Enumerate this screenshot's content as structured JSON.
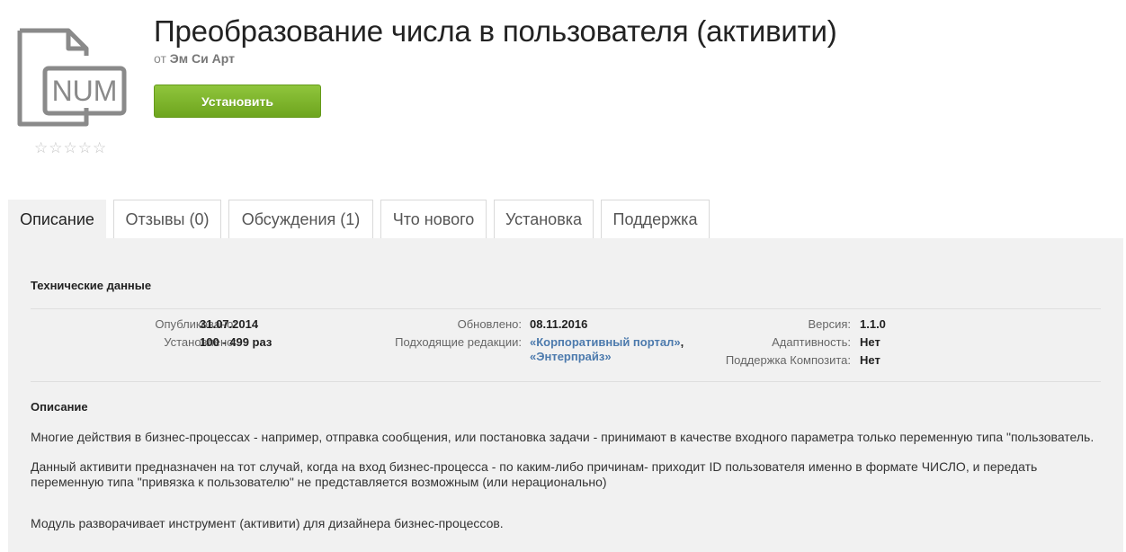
{
  "app": {
    "icon_text": "NUM",
    "title": "Преобразование числа в пользователя (активити)",
    "by_prefix": "от",
    "vendor": "Эм Си Арт",
    "install_label": "Установить",
    "rating": 0,
    "rating_max": 5
  },
  "tabs": [
    {
      "label": "Описание",
      "active": true
    },
    {
      "label": "Отзывы (0)",
      "active": false
    },
    {
      "label": "Обсуждения (1)",
      "active": false
    },
    {
      "label": "Что нового",
      "active": false
    },
    {
      "label": "Установка",
      "active": false
    },
    {
      "label": "Поддержка",
      "active": false
    }
  ],
  "tech": {
    "heading": "Технические данные",
    "published_label": "Опубликовано:",
    "published_value": "31.07.2014",
    "installed_label": "Установлено:",
    "installed_value": "100 - 499 раз",
    "updated_label": "Обновлено:",
    "updated_value": "08.11.2016",
    "editions_label": "Подходящие редакции:",
    "edition_1": "«Корпоративный портал»",
    "edition_sep": ",",
    "edition_2": "«Энтерпрайз»",
    "version_label": "Версия:",
    "version_value": "1.1.0",
    "adaptive_label": "Адаптивность:",
    "adaptive_value": "Нет",
    "composite_label": "Поддержка Композита:",
    "composite_value": "Нет"
  },
  "description": {
    "heading": "Описание",
    "p1": "Многие действия в бизнес-процессах - например, отправка сообщения, или постановка задачи - принимают в качестве входного параметра только переменную типа \"пользователь.",
    "p2": "Данный активити предназначен на тот случай, когда на вход бизнес-процесса - по каким-либо причинам- приходит ID пользователя именно в формате ЧИСЛО, и передать переменную типа \"привязка к пользователю\" не представляется возможным (или нерационально)",
    "p3": "Модуль разворачивает инструмент (активити) для дизайнера бизнес-процессов."
  },
  "colors": {
    "install_green": "#7ab52a",
    "link_blue": "#4c7aad",
    "panel_bg": "#f1f1f1"
  }
}
